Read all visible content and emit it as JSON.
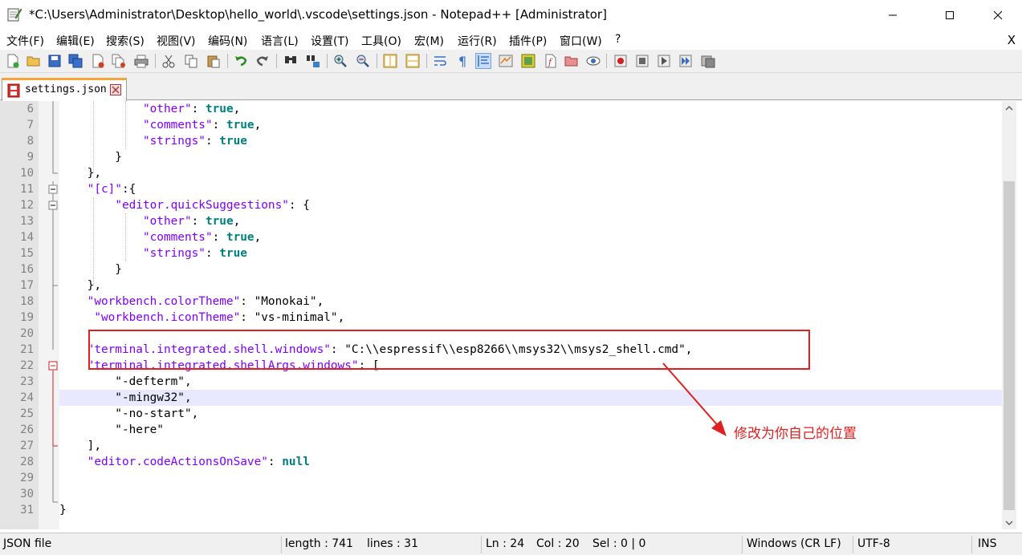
{
  "window": {
    "title": "*C:\\Users\\Administrator\\Desktop\\hello_world\\.vscode\\settings.json - Notepad++ [Administrator]",
    "app_icon": "notepad-icon",
    "controls": [
      "minimize-icon",
      "maximize-icon",
      "close-icon"
    ]
  },
  "menu": {
    "items": [
      "文件(F)",
      "编辑(E)",
      "搜索(S)",
      "视图(V)",
      "编码(N)",
      "语言(L)",
      "设置(T)",
      "工具(O)",
      "宏(M)",
      "运行(R)",
      "插件(P)",
      "窗口(W)",
      "?"
    ],
    "close_label": "X"
  },
  "toolbar": {
    "icons": [
      "new-file-icon",
      "open-file-icon",
      "save-icon",
      "save-all-icon",
      "close-icon",
      "close-all-icon",
      "print-icon",
      "cut-icon",
      "copy-icon",
      "paste-icon",
      "undo-icon",
      "redo-icon",
      "find-icon",
      "replace-icon",
      "zoom-in-icon",
      "zoom-out-icon",
      "sync-vertical-icon",
      "sync-horizontal-icon",
      "word-wrap-icon",
      "show-all-chars-icon",
      "indent-guide-icon",
      "user-language-icon",
      "document-map-icon",
      "function-list-icon",
      "folder-workspace-icon",
      "monitoring-icon",
      "record-macro-icon",
      "stop-record-icon",
      "play-macro-icon",
      "run-macro-multiple-icon",
      "save-macro-icon"
    ]
  },
  "tab": {
    "label": "settings.json",
    "icon": "unsaved-file-icon",
    "close_icon": "tab-close-icon"
  },
  "editor": {
    "current_line": 24,
    "lines": [
      {
        "n": "6",
        "code": [
          [
            "v",
            "            "
          ],
          [
            "k",
            "\"other\""
          ],
          [
            "p",
            ": "
          ],
          [
            "b",
            "true"
          ],
          [
            "p",
            ","
          ]
        ]
      },
      {
        "n": "7",
        "code": [
          [
            "v",
            "            "
          ],
          [
            "k",
            "\"comments\""
          ],
          [
            "p",
            ": "
          ],
          [
            "b",
            "true"
          ],
          [
            "p",
            ","
          ]
        ]
      },
      {
        "n": "8",
        "code": [
          [
            "v",
            "            "
          ],
          [
            "k",
            "\"strings\""
          ],
          [
            "p",
            ": "
          ],
          [
            "b",
            "true"
          ]
        ]
      },
      {
        "n": "9",
        "code": [
          [
            "p",
            "        }"
          ]
        ]
      },
      {
        "n": "10",
        "code": [
          [
            "p",
            "    },"
          ]
        ]
      },
      {
        "n": "11",
        "code": [
          [
            "p",
            "    "
          ],
          [
            "k",
            "\"[c]\""
          ],
          [
            "p",
            ":{"
          ]
        ]
      },
      {
        "n": "12",
        "code": [
          [
            "p",
            "        "
          ],
          [
            "k",
            "\"editor.quickSuggestions\""
          ],
          [
            "p",
            ": {"
          ]
        ]
      },
      {
        "n": "13",
        "code": [
          [
            "v",
            "            "
          ],
          [
            "k",
            "\"other\""
          ],
          [
            "p",
            ": "
          ],
          [
            "b",
            "true"
          ],
          [
            "p",
            ","
          ]
        ]
      },
      {
        "n": "14",
        "code": [
          [
            "v",
            "            "
          ],
          [
            "k",
            "\"comments\""
          ],
          [
            "p",
            ": "
          ],
          [
            "b",
            "true"
          ],
          [
            "p",
            ","
          ]
        ]
      },
      {
        "n": "15",
        "code": [
          [
            "v",
            "            "
          ],
          [
            "k",
            "\"strings\""
          ],
          [
            "p",
            ": "
          ],
          [
            "b",
            "true"
          ]
        ]
      },
      {
        "n": "16",
        "code": [
          [
            "p",
            "        }"
          ]
        ]
      },
      {
        "n": "17",
        "code": [
          [
            "p",
            "    },"
          ]
        ]
      },
      {
        "n": "18",
        "code": [
          [
            "p",
            "    "
          ],
          [
            "k",
            "\"workbench.colorTheme\""
          ],
          [
            "p",
            ": "
          ],
          [
            "p",
            "\"Monokai\""
          ],
          [
            "p",
            ","
          ]
        ]
      },
      {
        "n": "19",
        "code": [
          [
            "p",
            "     "
          ],
          [
            "k",
            "\"workbench.iconTheme\""
          ],
          [
            "p",
            ": "
          ],
          [
            "p",
            "\"vs-minimal\""
          ],
          [
            "p",
            ","
          ]
        ]
      },
      {
        "n": "20",
        "code": []
      },
      {
        "n": "21",
        "code": [
          [
            "p",
            "    "
          ],
          [
            "k",
            "\"terminal.integrated.shell.windows\""
          ],
          [
            "p",
            ": "
          ],
          [
            "p",
            "\"C:\\\\espressif\\\\esp8266\\\\msys32\\\\msys2_shell.cmd\""
          ],
          [
            "p",
            ","
          ]
        ]
      },
      {
        "n": "22",
        "code": [
          [
            "p",
            "    "
          ],
          [
            "k",
            "\"terminal.integrated.shellArgs.windows\""
          ],
          [
            "p",
            ": ["
          ]
        ]
      },
      {
        "n": "23",
        "code": [
          [
            "p",
            "        \"-defterm\","
          ]
        ]
      },
      {
        "n": "24",
        "code": [
          [
            "p",
            "        \"-mingw32\","
          ]
        ]
      },
      {
        "n": "25",
        "code": [
          [
            "p",
            "        \"-no-start\","
          ]
        ]
      },
      {
        "n": "26",
        "code": [
          [
            "p",
            "        \"-here\""
          ]
        ]
      },
      {
        "n": "27",
        "code": [
          [
            "p",
            "    ],"
          ]
        ]
      },
      {
        "n": "28",
        "code": [
          [
            "p",
            "    "
          ],
          [
            "k",
            "\"editor.codeActionsOnSave\""
          ],
          [
            "p",
            ": "
          ],
          [
            "b",
            "null"
          ]
        ]
      },
      {
        "n": "29",
        "code": []
      },
      {
        "n": "30",
        "code": []
      },
      {
        "n": "31",
        "code": [
          [
            "p",
            "}"
          ]
        ]
      }
    ]
  },
  "annotation": {
    "text": "修改为你自己的位置",
    "color": "#e02020"
  },
  "status": {
    "file_type": "JSON file",
    "length": "length : 741",
    "lines": "lines : 31",
    "ln": "Ln : 24",
    "col": "Col : 20",
    "sel": "Sel : 0 | 0",
    "eol": "Windows (CR LF)",
    "encoding": "UTF-8",
    "mode": "INS"
  }
}
